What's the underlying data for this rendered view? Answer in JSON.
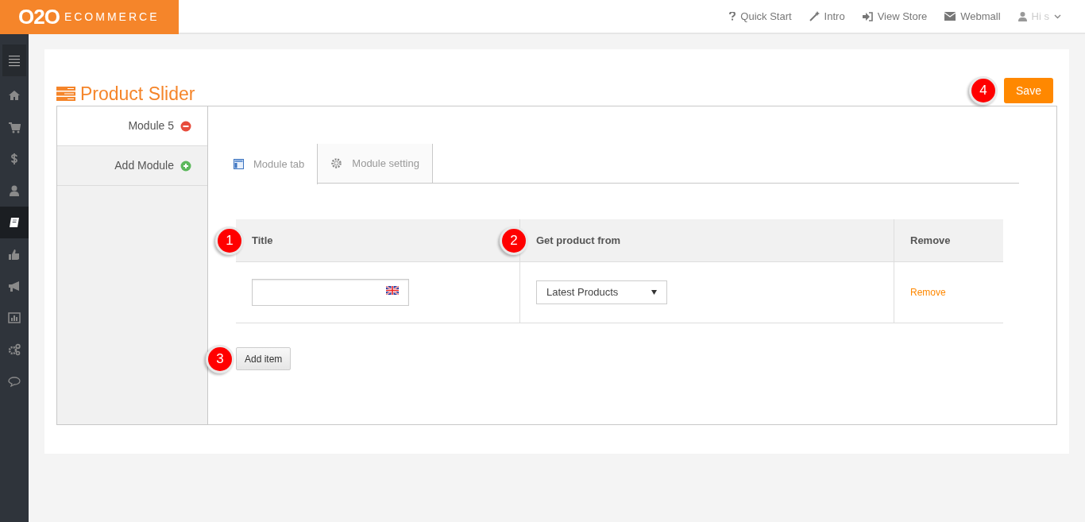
{
  "brand": {
    "mark": "O2O",
    "word": "ECOMMERCE"
  },
  "top_links": [
    {
      "kind": "help",
      "label": "Quick Start"
    },
    {
      "kind": "wand",
      "label": "Intro"
    },
    {
      "kind": "signin",
      "label": "View Store"
    },
    {
      "kind": "mail",
      "label": "Webmall"
    },
    {
      "kind": "user",
      "label": "Hi s"
    }
  ],
  "sidebar": {
    "items": [
      {
        "kind": "menu",
        "selected": false
      },
      {
        "kind": "home",
        "selected": false
      },
      {
        "kind": "cart",
        "selected": false
      },
      {
        "kind": "dollar",
        "selected": false
      },
      {
        "kind": "user",
        "selected": false
      },
      {
        "kind": "book",
        "selected": true
      },
      {
        "kind": "thumb",
        "selected": false
      },
      {
        "kind": "megaphone",
        "selected": false
      },
      {
        "kind": "chart",
        "selected": false
      },
      {
        "kind": "gears",
        "selected": false
      },
      {
        "kind": "chat",
        "selected": false
      }
    ]
  },
  "page": {
    "title": "Product Slider",
    "save": "Save",
    "save_callout": "4"
  },
  "modules": [
    {
      "kind": "module",
      "label": "Module 5",
      "selected": true
    },
    {
      "kind": "add",
      "label": "Add Module",
      "selected": false
    }
  ],
  "tabs": [
    {
      "kind": "layout",
      "label": "Module tab",
      "selected": true
    },
    {
      "kind": "gear",
      "label": "Module setting",
      "selected": false
    }
  ],
  "table": {
    "columns": [
      {
        "label": "Title",
        "callout": "1"
      },
      {
        "label": "Get product from",
        "callout": "2"
      },
      {
        "label": "Remove"
      }
    ],
    "rows": [
      {
        "title_value": "",
        "source": "Latest Products",
        "remove": "Remove"
      }
    ]
  },
  "add_item": {
    "label": "Add item",
    "callout": "3"
  }
}
